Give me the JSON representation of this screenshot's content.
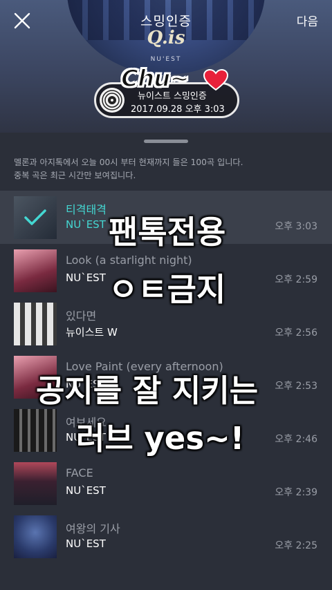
{
  "header": {
    "next_label": "다음",
    "cover_title": "스밍인증",
    "cover_logo": "Q.is",
    "cover_sub": "NU'EST",
    "stamp_title": "뉴이스트 스밍인증",
    "stamp_date": "2017.09.28 오후 3:03",
    "chu_text": "Chu~"
  },
  "notice": {
    "line1": "멜론과 아지톡에서 오늘 00시 부터 현재까지 들은 100곡 입니다.",
    "line2": "중복 곡은 최근 시간만 보여집니다."
  },
  "songs": [
    {
      "title": "티격태격",
      "artist": "NU`EST",
      "time": "오후 3:03",
      "thumb_colors": [
        "#5a6470",
        "#2d3440"
      ],
      "active": true
    },
    {
      "title": "Look (a starlight night)",
      "artist": "NU`EST",
      "time": "오후 2:59",
      "thumb_colors": [
        "#7a2a40",
        "#e9a0b0"
      ]
    },
    {
      "title": "있다면",
      "artist": "뉴이스트 W",
      "time": "오후 2:56",
      "thumb_colors": [
        "#e0e0e0",
        "#3a3a3a"
      ]
    },
    {
      "title": "Love Paint (every afternoon)",
      "artist": "NU`EST",
      "time": "오후 2:53",
      "thumb_colors": [
        "#7a2a40",
        "#e9a0b0"
      ]
    },
    {
      "title": "여보세요",
      "artist": "NU`EST",
      "time": "오후 2:46",
      "thumb_colors": [
        "#1a1a1a",
        "#6a6a6a"
      ]
    },
    {
      "title": "FACE",
      "artist": "NU`EST",
      "time": "오후 2:39",
      "thumb_colors": [
        "#1f1f2a",
        "#b0485a"
      ]
    },
    {
      "title": "여왕의 기사",
      "artist": "NU`EST",
      "time": "오후 2:25",
      "thumb_colors": [
        "#2a3a6a",
        "#d0c090"
      ]
    }
  ],
  "watermark": {
    "line1": "팬톡전용",
    "line2": "ㅇㅌ금지",
    "line3": "공지를 잘 지키는",
    "line4": "러브  yes~!"
  },
  "colors": {
    "accent": "#44d7d2",
    "background": "#2b2f39",
    "active_row": "#3b404b"
  }
}
